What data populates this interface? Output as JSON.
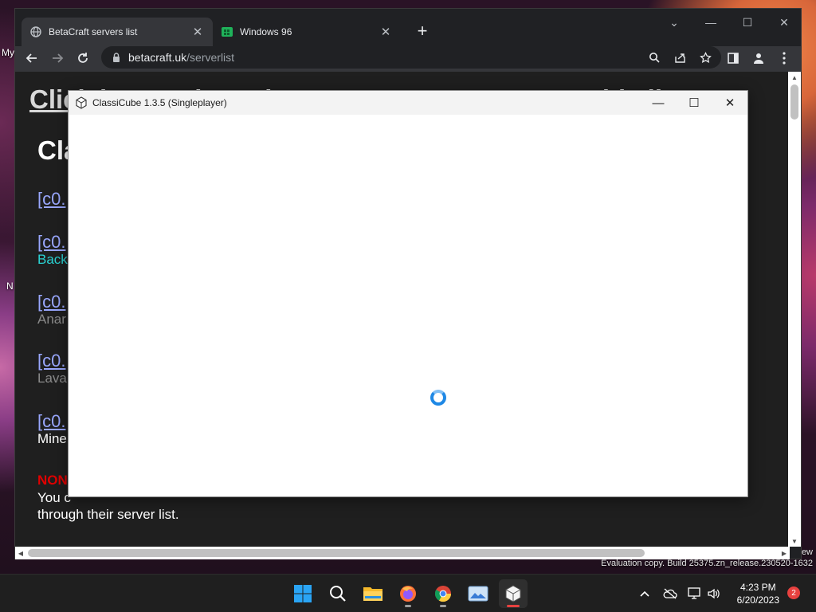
{
  "desktop": {
    "icon_labels": [
      "My",
      "N"
    ],
    "eval_text": "Evaluation copy. Build 25375.zn_release.230520-1632",
    "eval_text_top": "ew"
  },
  "browser": {
    "tabs": [
      {
        "title": "BetaCraft servers list",
        "active": true,
        "icon": "globe-icon"
      },
      {
        "title": "Windows 96",
        "active": false,
        "icon": "windows96-icon"
      }
    ],
    "new_tab_label": "+",
    "address": {
      "domain": "betacraft.uk",
      "path": "/serverlist"
    },
    "controls": {
      "minimize": "—",
      "maximize": "☐",
      "close": "✕",
      "dropdown": "⌄"
    }
  },
  "page": {
    "heading": "Click here to learn how to get your server on this list",
    "subheading": "Cla",
    "servers": [
      {
        "link": "[c0.",
        "desc": "",
        "desc_color": "#ffffff"
      },
      {
        "link": "[c0.",
        "desc": "Back",
        "desc_color": "#2ad3d3"
      },
      {
        "link": "[c0.",
        "desc": "Anar",
        "desc_color": "#8a8a8a"
      },
      {
        "link": "[c0.",
        "desc": "Lava",
        "desc_color": "#8a8a8a"
      },
      {
        "link": "[c0.",
        "desc": "Mine",
        "desc_color": "#ffffff"
      }
    ],
    "none_label": "NON",
    "footer_line1": "You c",
    "footer_line2": "through their server list."
  },
  "classicube": {
    "title": "ClassiCube 1.3.5 (Singleplayer)",
    "controls": {
      "minimize": "—",
      "maximize": "☐",
      "close": "✕"
    }
  },
  "taskbar": {
    "apps": [
      "start-button",
      "search-button",
      "file-explorer",
      "firefox",
      "chrome",
      "photos",
      "classicube"
    ],
    "active_app": "classicube",
    "clock_time": "4:23 PM",
    "clock_date": "6/20/2023",
    "notification_count": "2"
  },
  "colors": {
    "accent": "#1e88e5",
    "link": "#9aa8ff",
    "none_red": "#e00000"
  }
}
